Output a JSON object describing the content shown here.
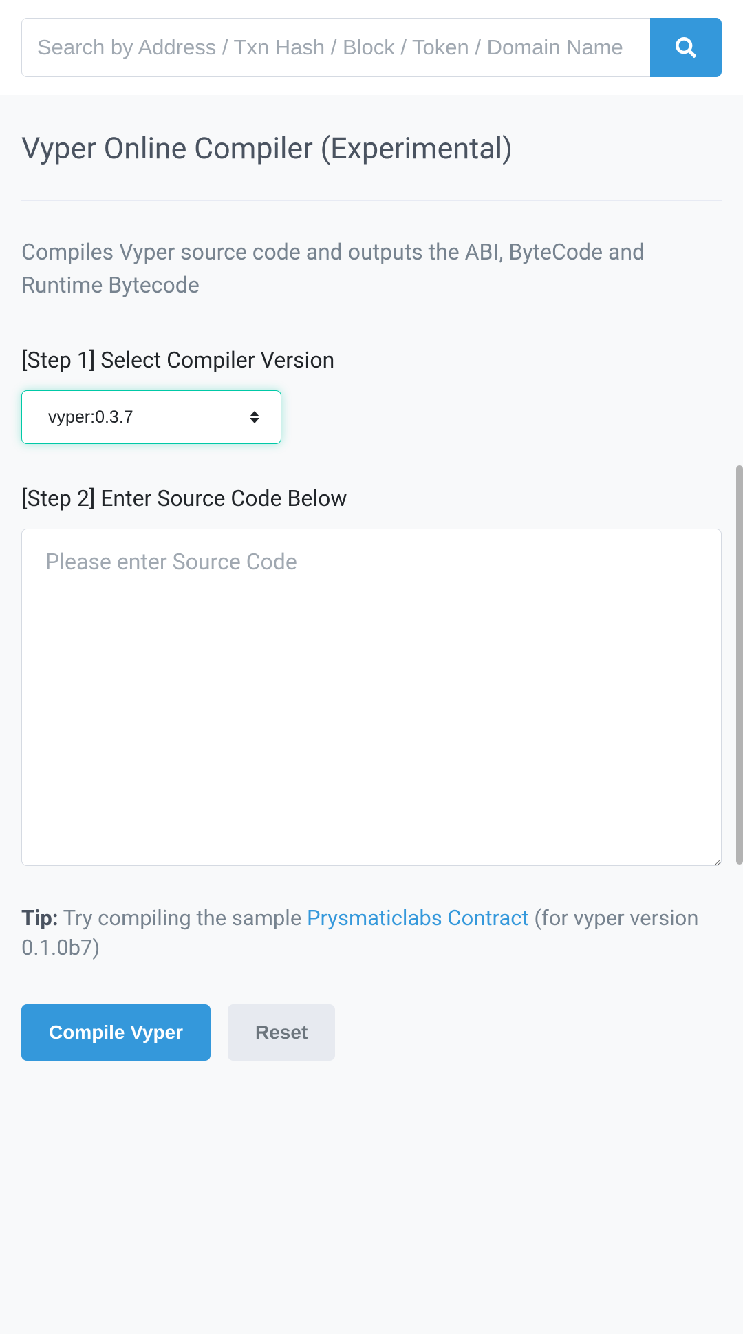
{
  "search": {
    "placeholder": "Search by Address / Txn Hash / Block / Token / Domain Name"
  },
  "header": {
    "title": "Vyper Online Compiler (Experimental)"
  },
  "description": "Compiles Vyper source code and outputs the ABI, ByteCode and Runtime Bytecode",
  "step1": {
    "label": "[Step 1] Select Compiler Version",
    "selected": "vyper:0.3.7"
  },
  "step2": {
    "label": "[Step 2] Enter Source Code Below",
    "placeholder": "Please enter Source Code"
  },
  "tip": {
    "label": "Tip:",
    "text_before": " Try compiling the sample ",
    "link_text": "Prysmaticlabs Contract",
    "text_after": " (for vyper version 0.1.0b7)"
  },
  "buttons": {
    "compile": "Compile Vyper",
    "reset": "Reset"
  }
}
